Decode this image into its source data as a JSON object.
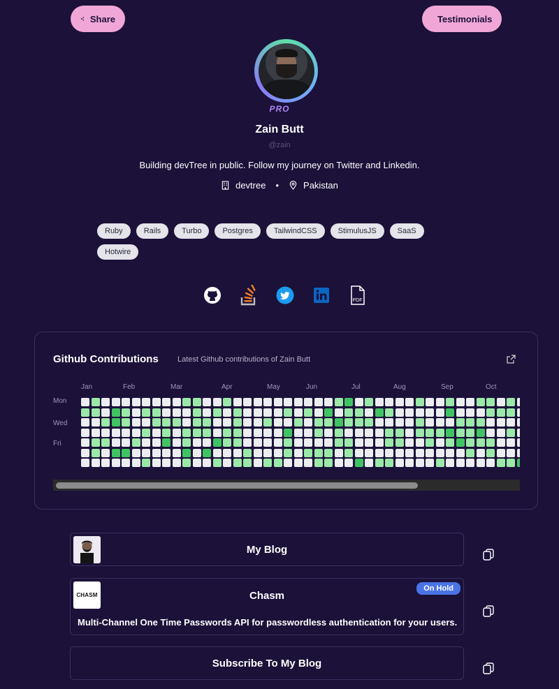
{
  "header": {
    "share_label": "Share",
    "testimonials_label": "Testimonials"
  },
  "profile": {
    "badge": "PRO",
    "name": "Zain Butt",
    "handle": "@zain",
    "bio": "Building devTree in public. Follow my journey on Twitter and Linkedin.",
    "company": "devtree",
    "separator": "•",
    "location": "Pakistan"
  },
  "tags": [
    "Ruby",
    "Rails",
    "Turbo",
    "Postgres",
    "TailwindCSS",
    "StimulusJS",
    "SaaS",
    "Hotwire"
  ],
  "socials": [
    "github-icon",
    "stackoverflow-icon",
    "twitter-icon",
    "linkedin-icon",
    "pdf-icon"
  ],
  "github": {
    "title": "Github Contributions",
    "subtitle": "Latest Github contributions of Zain Butt",
    "months": [
      "Jan",
      "Feb",
      "Mar",
      "Apr",
      "May",
      "Jun",
      "Jul",
      "Aug",
      "Sep",
      "Oct"
    ],
    "day_labels": [
      "Mon",
      "Wed",
      "Fri"
    ],
    "colors": {
      "empty": "#ebedf0",
      "level1": "#9be9a8",
      "level2": "#40c463"
    }
  },
  "links": [
    {
      "title": "My Blog"
    },
    {
      "title": "Chasm",
      "status": "On Hold",
      "description": "Multi-Channel One Time Passwords API for passwordless authentication for your users."
    },
    {
      "title": "Subscribe To My Blog"
    }
  ],
  "thumb_text": {
    "chasm": "CHASM"
  }
}
